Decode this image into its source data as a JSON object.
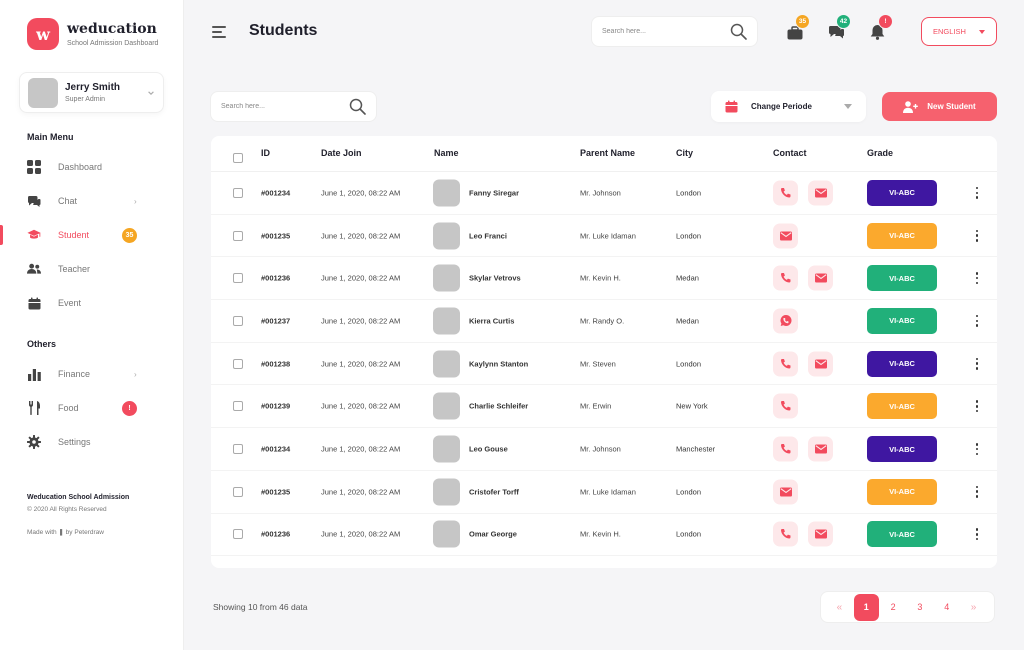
{
  "brand": {
    "logo_letter": "w",
    "name": "weducation",
    "subtitle": "School Admission Dashboard"
  },
  "profile": {
    "name": "Jerry Smith",
    "role": "Super Admin"
  },
  "sidebar": {
    "main_title": "Main Menu",
    "main_items": [
      {
        "label": "Dashboard",
        "icon": "dashboard-icon"
      },
      {
        "label": "Chat",
        "icon": "chat-icon",
        "has_submenu": true
      },
      {
        "label": "Student",
        "icon": "graduation-cap-icon",
        "active": true,
        "badge": "35",
        "badge_color": "#f5a623"
      },
      {
        "label": "Teacher",
        "icon": "users-icon"
      },
      {
        "label": "Event",
        "icon": "calendar-icon"
      }
    ],
    "others_title": "Others",
    "other_items": [
      {
        "label": "Finance",
        "icon": "bar-chart-icon",
        "has_submenu": true
      },
      {
        "label": "Food",
        "icon": "fork-knife-icon",
        "badge": "!",
        "badge_color": "#f24b5e"
      },
      {
        "label": "Settings",
        "icon": "gear-icon"
      }
    ],
    "footer_title": "Weducation School Admission",
    "footer_copy": "© 2020 All Rights Reserved",
    "footer_made": "Made with ❚ by Peterdraw"
  },
  "header": {
    "title": "Students",
    "search_placeholder": "Search here...",
    "badges": {
      "briefcase": "35",
      "chat": "42",
      "bell": "!"
    },
    "language": "ENGLISH"
  },
  "toolbar": {
    "search_placeholder": "Search here...",
    "period_label": "Change Periode",
    "new_student_label": "New Student"
  },
  "table": {
    "headers": {
      "id": "ID",
      "date": "Date Join",
      "name": "Name",
      "parent": "Parent Name",
      "city": "City",
      "contact": "Contact",
      "grade": "Grade"
    },
    "rows": [
      {
        "id": "#001234",
        "date": "June 1, 2020, 08:22 AM",
        "name": "Fanny Siregar",
        "parent": "Mr. Johnson",
        "city": "London",
        "contact": [
          "phone",
          "mail"
        ],
        "grade": "VI-ABC",
        "grade_color": "#3f17a1"
      },
      {
        "id": "#001235",
        "date": "June 1, 2020, 08:22 AM",
        "name": "Leo Franci",
        "parent": "Mr. Luke Idaman",
        "city": "London",
        "contact": [
          "mail"
        ],
        "grade": "VI-ABC",
        "grade_color": "#fba92d"
      },
      {
        "id": "#001236",
        "date": "June 1, 2020, 08:22 AM",
        "name": "Skylar Vetrovs",
        "parent": "Mr. Kevin H.",
        "city": "Medan",
        "contact": [
          "phone",
          "mail"
        ],
        "grade": "VI-ABC",
        "grade_color": "#21b07a"
      },
      {
        "id": "#001237",
        "date": "June 1, 2020, 08:22 AM",
        "name": "Kierra Curtis",
        "parent": "Mr. Randy O.",
        "city": "Medan",
        "contact": [
          "whatsapp"
        ],
        "grade": "VI-ABC",
        "grade_color": "#21b07a"
      },
      {
        "id": "#001238",
        "date": "June 1, 2020, 08:22 AM",
        "name": "Kaylynn Stanton",
        "parent": "Mr. Steven",
        "city": "London",
        "contact": [
          "phone",
          "mail"
        ],
        "grade": "VI-ABC",
        "grade_color": "#3f17a1"
      },
      {
        "id": "#001239",
        "date": "June 1, 2020, 08:22 AM",
        "name": "Charlie Schleifer",
        "parent": "Mr. Erwin",
        "city": "New York",
        "contact": [
          "phone"
        ],
        "grade": "VI-ABC",
        "grade_color": "#fba92d"
      },
      {
        "id": "#001234",
        "date": "June 1, 2020, 08:22 AM",
        "name": "Leo Gouse",
        "parent": "Mr. Johnson",
        "city": "Manchester",
        "contact": [
          "phone",
          "mail"
        ],
        "grade": "VI-ABC",
        "grade_color": "#3f17a1"
      },
      {
        "id": "#001235",
        "date": "June 1, 2020, 08:22 AM",
        "name": "Cristofer Torff",
        "parent": "Mr. Luke Idaman",
        "city": "London",
        "contact": [
          "mail"
        ],
        "grade": "VI-ABC",
        "grade_color": "#fba92d"
      },
      {
        "id": "#001236",
        "date": "June 1, 2020, 08:22 AM",
        "name": "Omar George",
        "parent": "Mr. Kevin H.",
        "city": "London",
        "contact": [
          "phone",
          "mail"
        ],
        "grade": "VI-ABC",
        "grade_color": "#21b07a"
      }
    ]
  },
  "pagination": {
    "summary": "Showing 10 from 46 data",
    "prev": "«",
    "next": "»",
    "pages": [
      "1",
      "2",
      "3",
      "4"
    ],
    "current": "1"
  },
  "colors": {
    "accent": "#f24b5e",
    "purple": "#3f17a1",
    "orange": "#fba92d",
    "green": "#21b07a"
  }
}
